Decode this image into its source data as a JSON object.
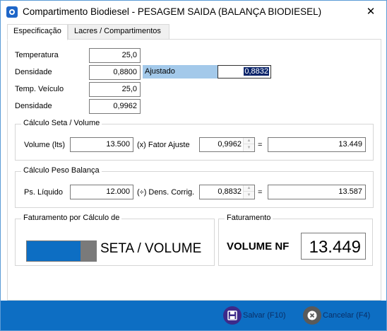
{
  "window": {
    "title": "Compartimento Biodiesel - PESAGEM SAIDA (BALANÇA BIODIESEL)",
    "close_glyph": "✕"
  },
  "tabs": [
    {
      "label": "Especificação",
      "active": true
    },
    {
      "label": "Lacres / Compartimentos",
      "active": false
    }
  ],
  "spec": {
    "temperatura": {
      "label": "Temperatura",
      "value": "25,0"
    },
    "densidade": {
      "label": "Densidade",
      "value": "0,8800"
    },
    "ajustado": {
      "label": "Ajustado",
      "value": "0,8832"
    },
    "temp_veiculo": {
      "label": "Temp. Veículo",
      "value": "25,0"
    },
    "densidade2": {
      "label": "Densidade",
      "value": "0,9962"
    }
  },
  "calc_seta": {
    "title": "Cálculo Seta / Volume",
    "volume_label": "Volume (lts)",
    "volume_value": "13.500",
    "fator_label": "(x) Fator Ajuste",
    "fator_value": "0,9962",
    "equals": "=",
    "result": "13.449"
  },
  "calc_peso": {
    "title": "Cálculo Peso Balança",
    "ps_label": "Ps. Líquido",
    "ps_value": "12.000",
    "dens_label": "(÷) Dens. Corrig.",
    "dens_value": "0,8832",
    "equals": "=",
    "result": "13.587"
  },
  "faturamento_calc": {
    "title": "Faturamento por Cálculo de",
    "mode_label": "SETA / VOLUME"
  },
  "faturamento": {
    "title": "Faturamento",
    "label": "VOLUME NF",
    "value": "13.449"
  },
  "footer": {
    "save_label": "Salvar (F10)",
    "cancel_label": "Cancelar (F4)"
  },
  "colors": {
    "accent": "#0d6ec3",
    "highlight": "#a3c9ea",
    "selection": "#0a246a"
  },
  "icons": {
    "app": "app-logo-icon",
    "close": "close-icon",
    "save": "save-icon",
    "cancel": "cancel-icon",
    "spin_up": "chevron-up-icon",
    "spin_down": "chevron-down-icon"
  }
}
